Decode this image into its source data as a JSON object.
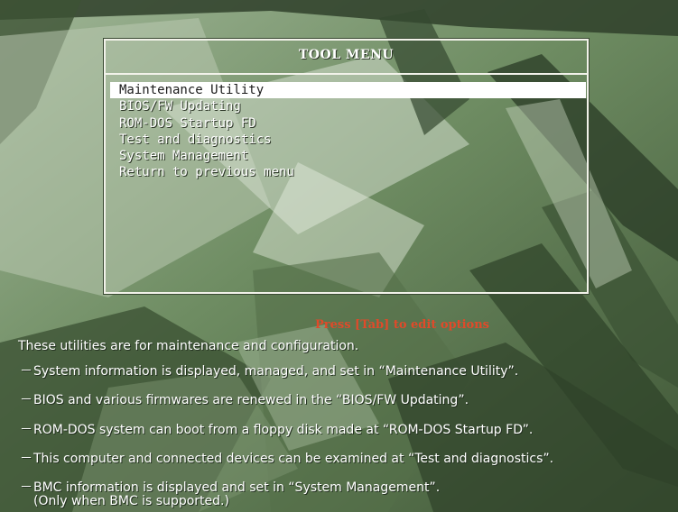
{
  "menu": {
    "title": "TOOL MENU",
    "selected_index": 0,
    "items": [
      {
        "label": "Maintenance Utility"
      },
      {
        "label": "BIOS/FW Updating"
      },
      {
        "label": "ROM-DOS Startup FD"
      },
      {
        "label": "Test and diagnostics"
      },
      {
        "label": "System Management"
      },
      {
        "label": "Return to previous menu"
      }
    ]
  },
  "hint": "Press [Tab] to edit options",
  "intro": "These utilities are for maintenance and configuration.",
  "descriptions": [
    {
      "dash": "－",
      "text": "System information is displayed, managed, and set in “Maintenance Utility”."
    },
    {
      "dash": "－",
      "text": "BIOS and various firmwares are renewed in the “BIOS/FW Updating”."
    },
    {
      "dash": "－",
      "text": "ROM-DOS system can boot from a floppy disk made at “ROM-DOS Startup FD”."
    },
    {
      "dash": "－",
      "text": "This computer and connected devices can be examined at “Test and diagnostics”."
    },
    {
      "dash": "－",
      "text": "BMC information is displayed and set in “System Management”.",
      "note": "(Only when BMC is supported.)"
    }
  ],
  "colors": {
    "hint": "#e04a2a",
    "text": "#ffffff",
    "highlight_bg": "#ffffff",
    "highlight_fg": "#1a1a1a"
  }
}
